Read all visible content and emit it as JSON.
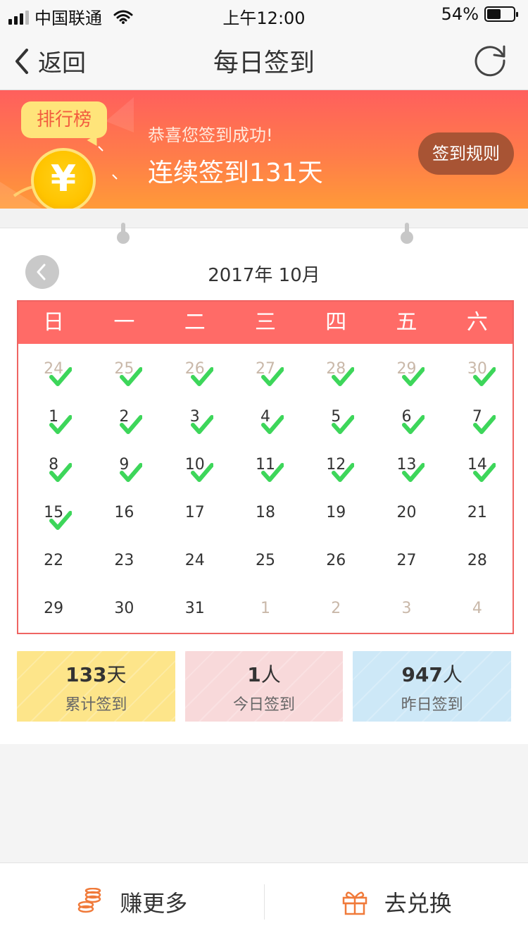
{
  "status_bar": {
    "carrier": "中国联通",
    "time": "上午12:00",
    "battery_percent": "54%",
    "battery_level": 0.54
  },
  "nav": {
    "back_label": "返回",
    "title": "每日签到",
    "back_icon": "chevron-left-icon",
    "refresh_icon": "refresh-icon"
  },
  "banner": {
    "rank_label": "排行榜",
    "coin_symbol": "¥",
    "subtitle": "恭喜您签到成功!",
    "main_text": "连续签到131天",
    "rules_label": "签到规则"
  },
  "calendar": {
    "month_title": "2017年 10月",
    "weekdays": [
      "日",
      "一",
      "二",
      "三",
      "四",
      "五",
      "六"
    ],
    "weeks": [
      [
        {
          "d": "24",
          "o": true,
          "c": true
        },
        {
          "d": "25",
          "o": true,
          "c": true
        },
        {
          "d": "26",
          "o": true,
          "c": true
        },
        {
          "d": "27",
          "o": true,
          "c": true
        },
        {
          "d": "28",
          "o": true,
          "c": true
        },
        {
          "d": "29",
          "o": true,
          "c": true
        },
        {
          "d": "30",
          "o": true,
          "c": true
        }
      ],
      [
        {
          "d": "1",
          "o": false,
          "c": true
        },
        {
          "d": "2",
          "o": false,
          "c": true
        },
        {
          "d": "3",
          "o": false,
          "c": true
        },
        {
          "d": "4",
          "o": false,
          "c": true
        },
        {
          "d": "5",
          "o": false,
          "c": true
        },
        {
          "d": "6",
          "o": false,
          "c": true
        },
        {
          "d": "7",
          "o": false,
          "c": true
        }
      ],
      [
        {
          "d": "8",
          "o": false,
          "c": true
        },
        {
          "d": "9",
          "o": false,
          "c": true
        },
        {
          "d": "10",
          "o": false,
          "c": true
        },
        {
          "d": "11",
          "o": false,
          "c": true
        },
        {
          "d": "12",
          "o": false,
          "c": true
        },
        {
          "d": "13",
          "o": false,
          "c": true
        },
        {
          "d": "14",
          "o": false,
          "c": true
        }
      ],
      [
        {
          "d": "15",
          "o": false,
          "c": true
        },
        {
          "d": "16",
          "o": false,
          "c": false
        },
        {
          "d": "17",
          "o": false,
          "c": false
        },
        {
          "d": "18",
          "o": false,
          "c": false
        },
        {
          "d": "19",
          "o": false,
          "c": false
        },
        {
          "d": "20",
          "o": false,
          "c": false
        },
        {
          "d": "21",
          "o": false,
          "c": false
        }
      ],
      [
        {
          "d": "22",
          "o": false,
          "c": false
        },
        {
          "d": "23",
          "o": false,
          "c": false
        },
        {
          "d": "24",
          "o": false,
          "c": false
        },
        {
          "d": "25",
          "o": false,
          "c": false
        },
        {
          "d": "26",
          "o": false,
          "c": false
        },
        {
          "d": "27",
          "o": false,
          "c": false
        },
        {
          "d": "28",
          "o": false,
          "c": false
        }
      ],
      [
        {
          "d": "29",
          "o": false,
          "c": false
        },
        {
          "d": "30",
          "o": false,
          "c": false
        },
        {
          "d": "31",
          "o": false,
          "c": false
        },
        {
          "d": "1",
          "o": true,
          "c": false
        },
        {
          "d": "2",
          "o": true,
          "c": false
        },
        {
          "d": "3",
          "o": true,
          "c": false
        },
        {
          "d": "4",
          "o": true,
          "c": false
        }
      ]
    ]
  },
  "stats": [
    {
      "value": "133",
      "unit": "天",
      "label": "累计签到",
      "color": "#fde58a"
    },
    {
      "value": "1",
      "unit": "人",
      "label": "今日签到",
      "color": "#f8d9da"
    },
    {
      "value": "947",
      "unit": "人",
      "label": "昨日签到",
      "color": "#cde8f7"
    }
  ],
  "bottom_bar": {
    "earn_label": "赚更多",
    "earn_icon": "coins-icon",
    "exchange_label": "去兑换",
    "exchange_icon": "gift-icon"
  },
  "colors": {
    "accent": "#ff6b67",
    "check": "#3dd65a",
    "rules_button": "#a85434"
  }
}
